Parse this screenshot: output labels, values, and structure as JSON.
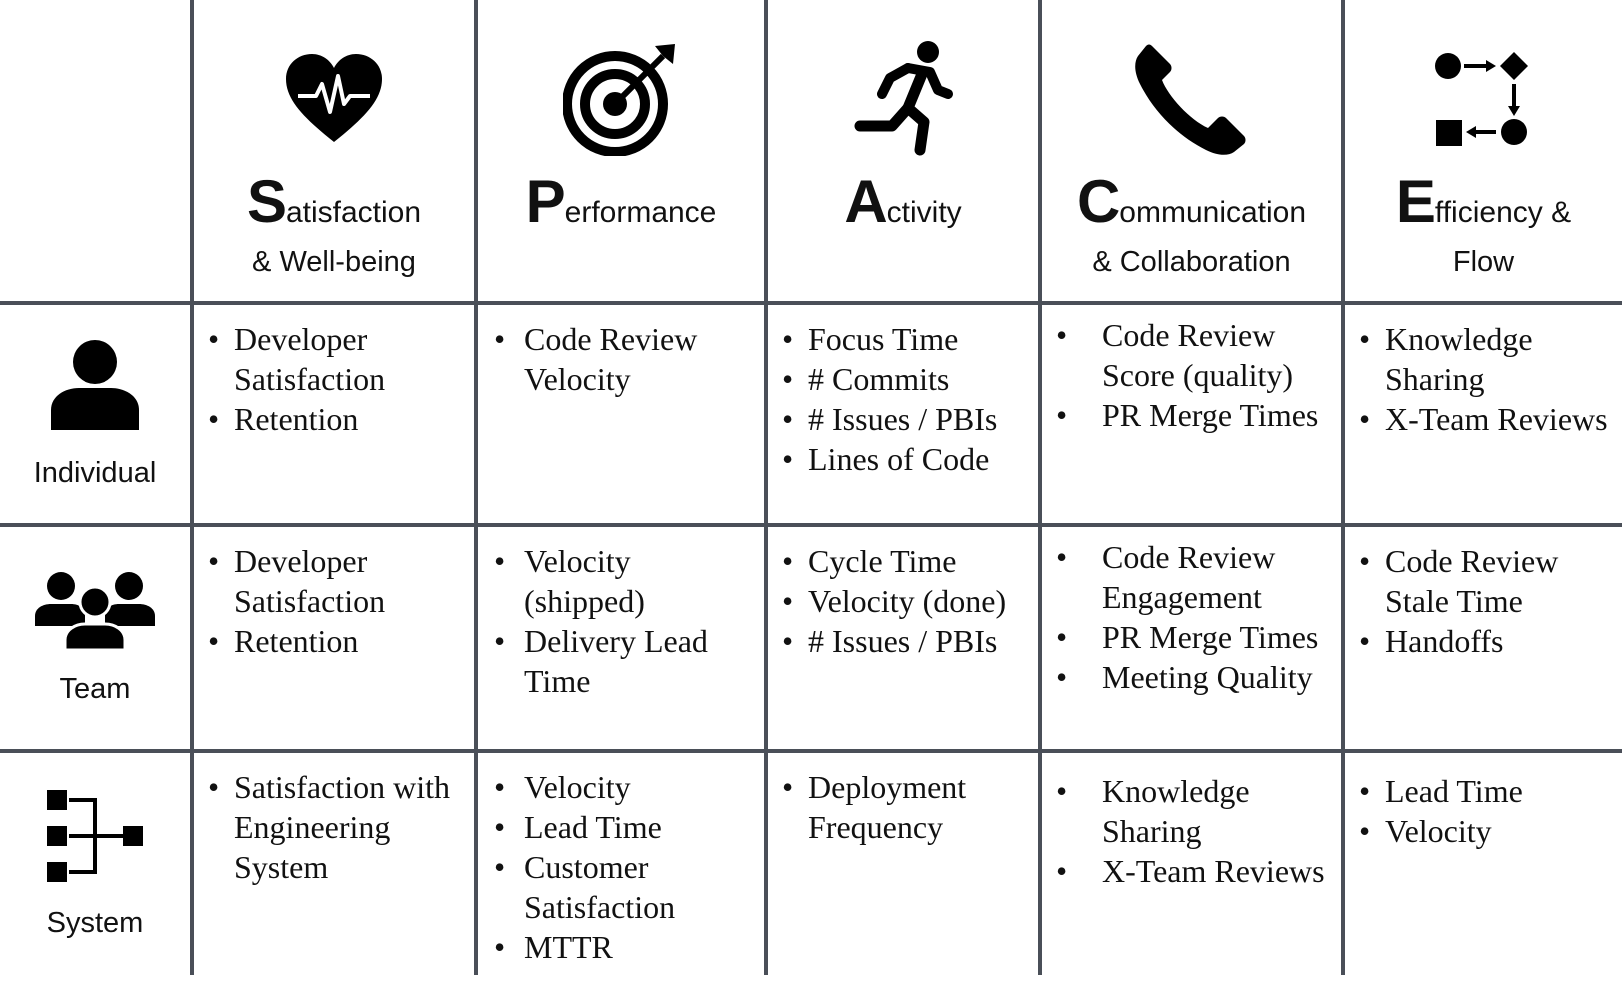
{
  "header": {
    "columns": [
      {
        "cap": "S",
        "rest": "atisfaction",
        "sub": "& Well-being",
        "icon": "heart-pulse-icon"
      },
      {
        "cap": "P",
        "rest": "erformance",
        "sub": "",
        "icon": "target-icon"
      },
      {
        "cap": "A",
        "rest": "ctivity",
        "sub": "",
        "icon": "running-person-icon"
      },
      {
        "cap": "C",
        "rest": "ommunication",
        "sub": "& Collaboration",
        "icon": "phone-icon"
      },
      {
        "cap": "E",
        "rest": "fficiency &",
        "sub": "Flow",
        "icon": "flow-icon"
      }
    ]
  },
  "rows": [
    {
      "label": "Individual",
      "icon": "person-icon",
      "cells": [
        [
          "Developer Satisfaction",
          "Retention"
        ],
        [
          "Code Review Velocity"
        ],
        [
          "Focus Time",
          "# Commits",
          "# Issues / PBIs",
          "Lines of Code"
        ],
        [
          "Code Review Score (quality)",
          "PR Merge Times"
        ],
        [
          "Knowledge Sharing",
          "X-Team Reviews"
        ]
      ]
    },
    {
      "label": "Team",
      "icon": "group-icon",
      "cells": [
        [
          "Developer Satisfaction",
          "Retention"
        ],
        [
          "Velocity (shipped)",
          "Delivery Lead Time"
        ],
        [
          "Cycle Time",
          "Velocity (done)",
          "# Issues / PBIs"
        ],
        [
          "Code Review Engagement",
          "PR Merge Times",
          "Meeting Quality"
        ],
        [
          "Code Review Stale Time",
          "Handoffs"
        ]
      ]
    },
    {
      "label": "System",
      "icon": "system-tree-icon",
      "cells": [
        [
          "Satisfaction with Engineering System"
        ],
        [
          "Velocity",
          "Lead Time",
          "Customer Satisfaction",
          "MTTR"
        ],
        [
          "Deployment Frequency"
        ],
        [
          "Knowledge Sharing",
          "X-Team Reviews"
        ],
        [
          "Lead Time",
          "Velocity"
        ]
      ]
    }
  ]
}
